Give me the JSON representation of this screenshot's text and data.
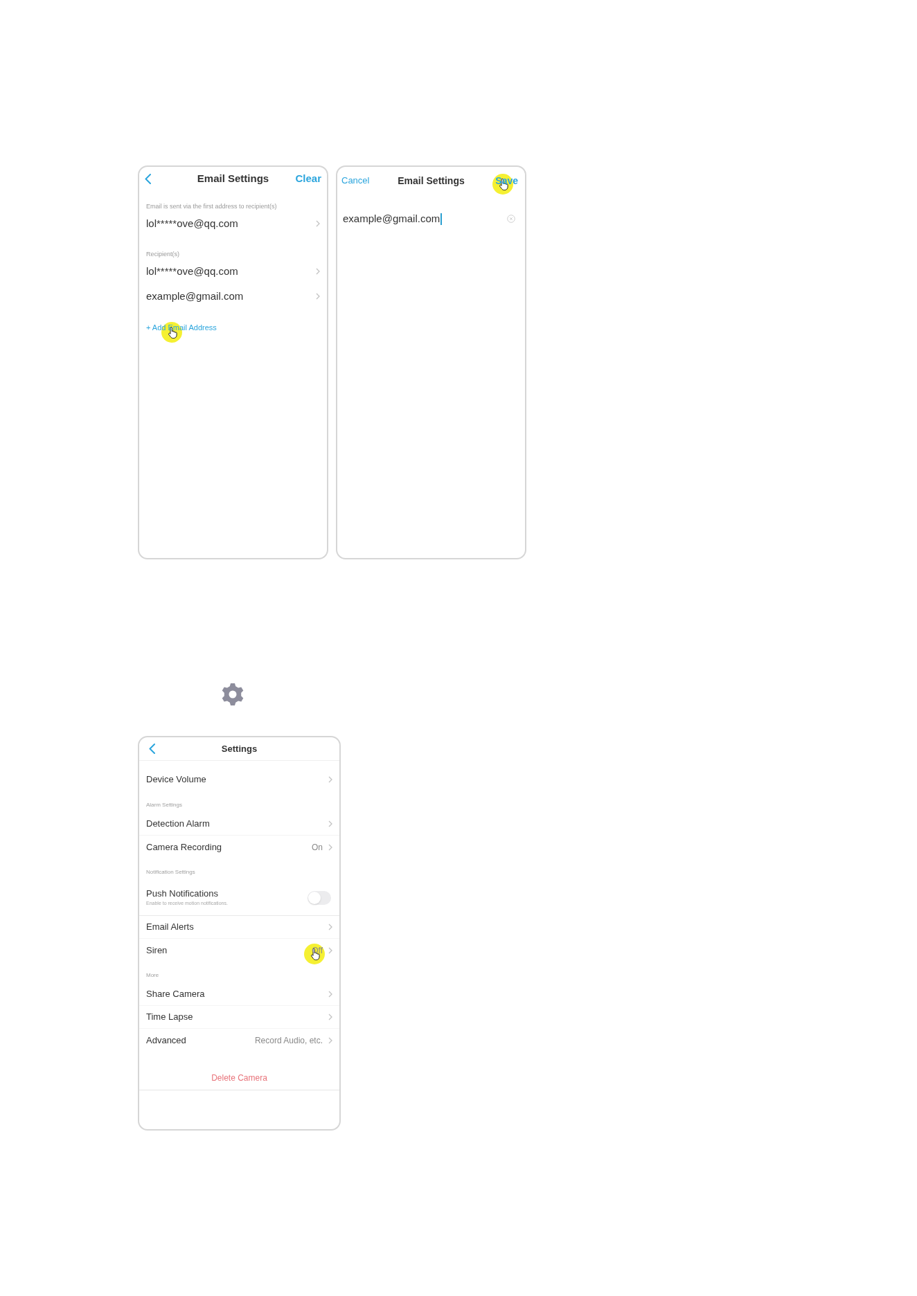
{
  "email_list_screen": {
    "title": "Email Settings",
    "action": "Clear",
    "groups": [
      {
        "label": "Email is sent via the first address to recipient(s)",
        "emails": [
          {
            "address": "lol*****ove@qq.com"
          }
        ]
      },
      {
        "label": "Recipient(s)",
        "emails": [
          {
            "address": "lol*****ove@qq.com"
          },
          {
            "address": "example@gmail.com"
          }
        ]
      }
    ],
    "add_link": {
      "label": "+ Add Email Address",
      "tapped": true
    }
  },
  "email_edit_screen": {
    "cancel": "Cancel",
    "title": "Email Settings",
    "save": {
      "label": "Save",
      "tapped": true
    },
    "email_field": {
      "value": "example@gmail.com",
      "focused": true
    }
  },
  "settings_screen": {
    "title": "Settings",
    "sections": [
      {
        "items": [
          {
            "kind": "link",
            "label": "Device Volume",
            "tapped": false
          }
        ]
      },
      {
        "label": "Alarm Settings",
        "items": [
          {
            "kind": "link",
            "label": "Detection Alarm",
            "tapped": false
          },
          {
            "kind": "link",
            "label": "Camera Recording",
            "value": "On",
            "tapped": false
          }
        ]
      },
      {
        "label": "Notification Settings",
        "items": [
          {
            "kind": "toggle",
            "label": "Push Notifications",
            "description": "Enable to receive motion notifications.",
            "on": false
          },
          {
            "kind": "link",
            "label": "Email Alerts",
            "tapped": false
          },
          {
            "kind": "link",
            "label": "Siren",
            "value": "Off",
            "tapped": true
          }
        ]
      },
      {
        "label": "More",
        "items": [
          {
            "kind": "link",
            "label": "Share Camera",
            "tapped": false
          },
          {
            "kind": "link",
            "label": "Time Lapse",
            "tapped": false
          },
          {
            "kind": "link",
            "label": "Advanced",
            "value": "Record Audio, etc.",
            "tapped": false
          }
        ]
      }
    ],
    "delete_button": "Delete Camera"
  }
}
